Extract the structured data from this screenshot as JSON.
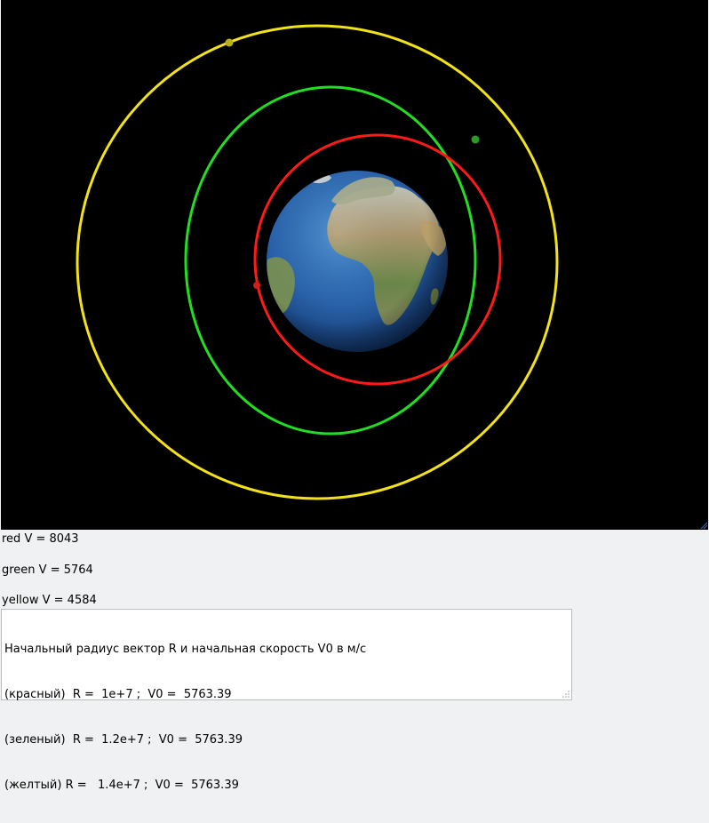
{
  "scene": {
    "background": "#000000",
    "earth": {
      "ocean_color": "#2e6fb8",
      "land_color": "#8a9a55"
    },
    "orbits": [
      {
        "name": "red",
        "color": "#ff1a1a",
        "satellite_color": "#d0201a"
      },
      {
        "name": "green",
        "color": "#22dd22",
        "satellite_color": "#2a9a2a"
      },
      {
        "name": "yellow",
        "color": "#f2e21a",
        "satellite_color": "#b9b21a"
      }
    ]
  },
  "velocities": {
    "red": "red V = 8043",
    "green": "green V = 5764",
    "yellow": "yellow V = 4584"
  },
  "info": {
    "header": "Начальный радиус вектор R и начальная скорость V0 в м/с",
    "lines": [
      "(красный)  R =  1e+7 ;  V0 =  5763.39",
      "(зеленый)  R =  1.2e+7 ;  V0 =  5763.39",
      "(желтый) R =   1.4e+7 ;  V0 =  5763.39"
    ]
  }
}
